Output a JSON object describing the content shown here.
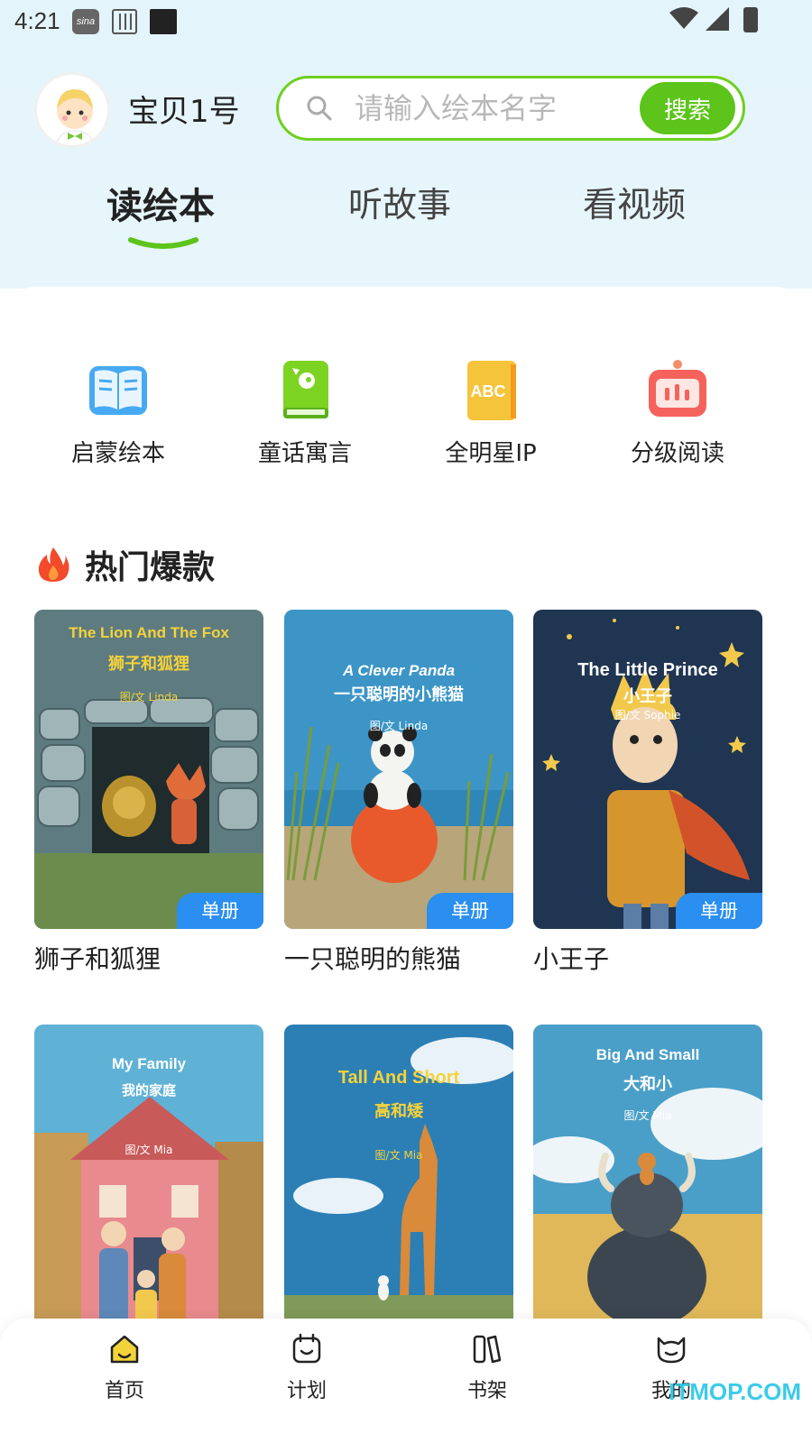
{
  "status_bar": {
    "time": "4:21",
    "sina_label": "sina"
  },
  "header": {
    "username": "宝贝1号",
    "search": {
      "placeholder": "请输入绘本名字",
      "value": "",
      "button_label": "搜索"
    }
  },
  "tabs": [
    {
      "label": "读绘本",
      "active": true
    },
    {
      "label": "听故事",
      "active": false
    },
    {
      "label": "看视频",
      "active": false
    }
  ],
  "categories": [
    {
      "label": "启蒙绘本",
      "icon": "open-book-icon"
    },
    {
      "label": "童话寓言",
      "icon": "bird-book-icon"
    },
    {
      "label": "全明星IP",
      "icon": "abc-book-icon"
    },
    {
      "label": "分级阅读",
      "icon": "level-reading-icon"
    }
  ],
  "section": {
    "title": "热门爆款",
    "icon": "fire-icon"
  },
  "books": [
    {
      "title": "狮子和狐狸",
      "cover_en": "The Lion And The Fox",
      "cover_cn": "狮子和狐狸",
      "cover_author": "图/文 Linda",
      "badge": "单册"
    },
    {
      "title": "一只聪明的熊猫",
      "cover_en": "A Clever Panda",
      "cover_cn": "一只聪明的小熊猫",
      "cover_author": "图/文  Linda",
      "badge": "单册"
    },
    {
      "title": "小王子",
      "cover_en": "The Little Prince",
      "cover_cn": "小王子",
      "cover_author": "图/文 Sophie",
      "badge": "单册"
    },
    {
      "title": "",
      "cover_en": "My Family",
      "cover_cn": "我的家庭",
      "cover_author": "图/文 Mia",
      "badge": ""
    },
    {
      "title": "",
      "cover_en": "Tall And Short",
      "cover_cn": "高和矮",
      "cover_author": "图/文 Mia",
      "badge": ""
    },
    {
      "title": "",
      "cover_en": "Big And Small",
      "cover_cn": "大和小",
      "cover_author": "图/文 Mia",
      "badge": ""
    }
  ],
  "bottom_nav": [
    {
      "label": "首页",
      "icon": "home-icon",
      "active": true
    },
    {
      "label": "计划",
      "icon": "plan-icon",
      "active": false
    },
    {
      "label": "书架",
      "icon": "bookshelf-icon",
      "active": false
    },
    {
      "label": "我的",
      "icon": "profile-icon",
      "active": false
    }
  ],
  "watermark": "ITMOP.COM",
  "colors": {
    "accent_green": "#5cc41a",
    "badge_blue": "#2a8ff0",
    "header_bg": "#e3f4fb"
  }
}
